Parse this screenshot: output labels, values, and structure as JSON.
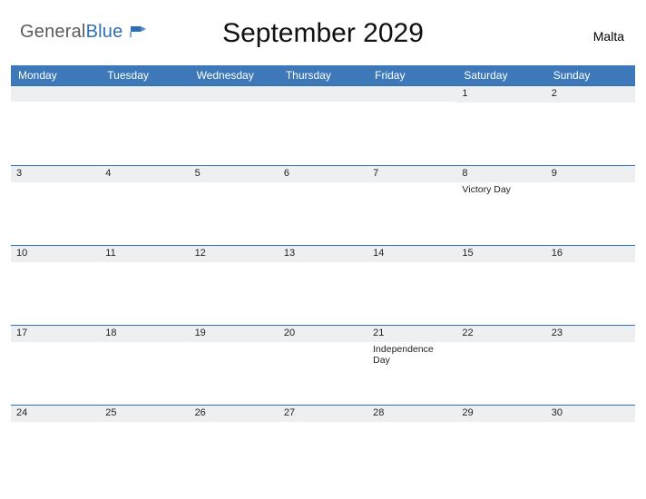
{
  "brand": {
    "part1": "General",
    "part2": "Blue"
  },
  "title": "September 2029",
  "region": "Malta",
  "days_of_week": [
    "Monday",
    "Tuesday",
    "Wednesday",
    "Thursday",
    "Friday",
    "Saturday",
    "Sunday"
  ],
  "weeks": [
    [
      {
        "n": "",
        "e": ""
      },
      {
        "n": "",
        "e": ""
      },
      {
        "n": "",
        "e": ""
      },
      {
        "n": "",
        "e": ""
      },
      {
        "n": "",
        "e": ""
      },
      {
        "n": "1",
        "e": ""
      },
      {
        "n": "2",
        "e": ""
      }
    ],
    [
      {
        "n": "3",
        "e": ""
      },
      {
        "n": "4",
        "e": ""
      },
      {
        "n": "5",
        "e": ""
      },
      {
        "n": "6",
        "e": ""
      },
      {
        "n": "7",
        "e": ""
      },
      {
        "n": "8",
        "e": "Victory Day"
      },
      {
        "n": "9",
        "e": ""
      }
    ],
    [
      {
        "n": "10",
        "e": ""
      },
      {
        "n": "11",
        "e": ""
      },
      {
        "n": "12",
        "e": ""
      },
      {
        "n": "13",
        "e": ""
      },
      {
        "n": "14",
        "e": ""
      },
      {
        "n": "15",
        "e": ""
      },
      {
        "n": "16",
        "e": ""
      }
    ],
    [
      {
        "n": "17",
        "e": ""
      },
      {
        "n": "18",
        "e": ""
      },
      {
        "n": "19",
        "e": ""
      },
      {
        "n": "20",
        "e": ""
      },
      {
        "n": "21",
        "e": "Independence Day"
      },
      {
        "n": "22",
        "e": ""
      },
      {
        "n": "23",
        "e": ""
      }
    ],
    [
      {
        "n": "24",
        "e": ""
      },
      {
        "n": "25",
        "e": ""
      },
      {
        "n": "26",
        "e": ""
      },
      {
        "n": "27",
        "e": ""
      },
      {
        "n": "28",
        "e": ""
      },
      {
        "n": "29",
        "e": ""
      },
      {
        "n": "30",
        "e": ""
      }
    ]
  ]
}
